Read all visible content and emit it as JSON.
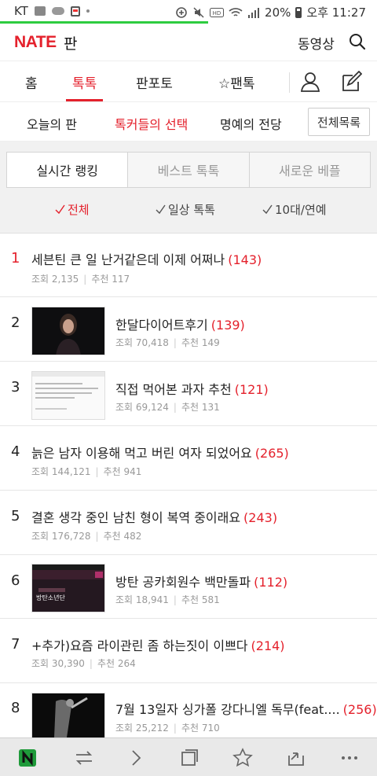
{
  "status_bar": {
    "carrier": "KT",
    "battery": "20%",
    "time": "오후 11:27"
  },
  "header": {
    "logo": "NATE",
    "logo_sub": "판",
    "video_link": "동영상"
  },
  "main_tabs": [
    "홈",
    "톡톡",
    "판포토",
    "☆팬톡"
  ],
  "sub_tabs": [
    "오늘의 판",
    "톡커들의 선택",
    "명예의 전당"
  ],
  "all_list_button": "전체목록",
  "segments": [
    "실시간 랭킹",
    "베스트 톡톡",
    "새로운 베플"
  ],
  "filters": [
    "전체",
    "일상 톡톡",
    "10대/연예"
  ],
  "meta_labels": {
    "views": "조회",
    "recommend": "추천"
  },
  "posts": [
    {
      "rank": "1",
      "title": "세븐틴 큰 일 난거같은데 이제 어쩌나",
      "comments": "(143)",
      "views": "2,135",
      "recommend": "117"
    },
    {
      "rank": "2",
      "title": "한달다이어트후기",
      "comments": "(139)",
      "views": "70,418",
      "recommend": "149"
    },
    {
      "rank": "3",
      "title": "직접 먹어본 과자 추천",
      "comments": "(121)",
      "views": "69,124",
      "recommend": "131"
    },
    {
      "rank": "4",
      "title": "늙은 남자 이용해 먹고 버린 여자 되었어요",
      "comments": "(265)",
      "views": "144,121",
      "recommend": "941"
    },
    {
      "rank": "5",
      "title": "결혼 생각 중인 남친 형이 복역 중이래요",
      "comments": "(243)",
      "views": "176,728",
      "recommend": "482"
    },
    {
      "rank": "6",
      "title": "방탄 공카회원수 백만돌파",
      "comments": "(112)",
      "views": "18,941",
      "recommend": "581"
    },
    {
      "rank": "7",
      "title": "+추가)요즘 라이관린 좀 하는짓이 이쁘다",
      "comments": "(214)",
      "views": "30,390",
      "recommend": "264"
    },
    {
      "rank": "8",
      "title": "7월 13일자 싱가폴 강다니엘 독무(feat....",
      "comments": "(256)",
      "views": "25,212",
      "recommend": "710"
    }
  ],
  "thumb6_text": "방탄소년단",
  "colors": {
    "accent": "#e4212c",
    "load_bar": "#2ecc40"
  }
}
